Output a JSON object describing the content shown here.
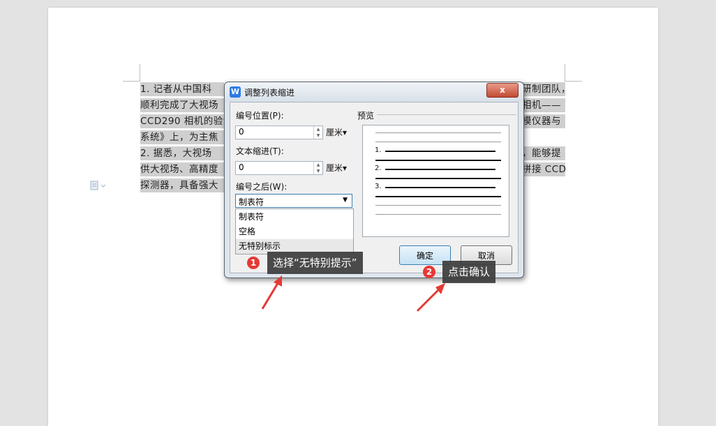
{
  "document": {
    "lines": [
      {
        "left_text": "1.     记者从中国科",
        "right_text": "研制团队，"
      },
      {
        "left_text": "顺利完成了大视场",
        "right_text": "相机——"
      },
      {
        "left_text": "CCD290 相机的验证",
        "right_text": "模仪器与"
      },
      {
        "left_text": "系统》上，为主焦",
        "right_text": ""
      },
      {
        "left_text": "2.     据悉，大视场",
        "right_text": "，能够提"
      },
      {
        "left_text": "供大视场、高精度",
        "right_text": "拼接 CCD"
      },
      {
        "left_text": "探测器，具备强大",
        "right_text": ""
      }
    ]
  },
  "dialog": {
    "title": "调整列表缩进",
    "close_label": "x",
    "number_position_label": "编号位置(P):",
    "number_position_value": "0",
    "number_position_unit": "厘米▾",
    "text_indent_label": "文本缩进(T):",
    "text_indent_value": "0",
    "text_indent_unit": "厘米▾",
    "after_number_label": "编号之后(W):",
    "after_number_selected": "制表符",
    "after_number_options": [
      "制表符",
      "空格",
      "无特别标示"
    ],
    "preview_label": "预览",
    "preview_numbers": [
      "1.",
      "2.",
      "3."
    ],
    "ok_label": "确定",
    "cancel_label": "取消"
  },
  "annotations": [
    {
      "badge": "1",
      "text": "选择“无特别提示”"
    },
    {
      "badge": "2",
      "text": "点击确认"
    }
  ],
  "colors": {
    "callout_bg": "#3c3c3c",
    "badge": "#e53935",
    "arrow": "#e53935"
  }
}
